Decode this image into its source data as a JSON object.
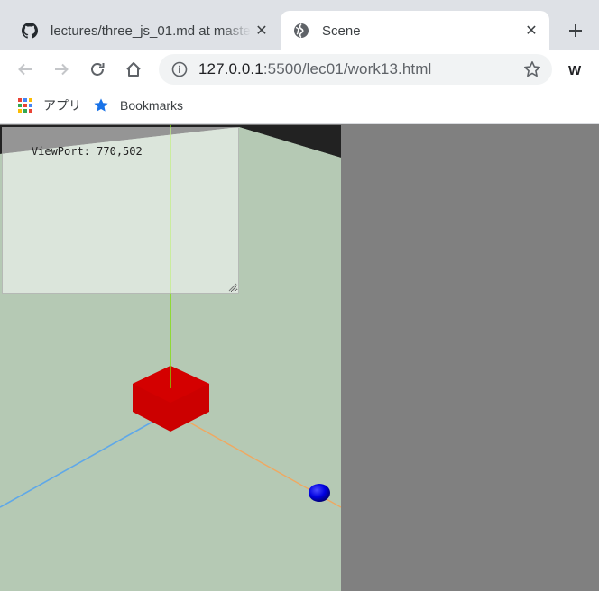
{
  "browser": {
    "tabs": [
      {
        "title": "lectures/three_js_01.md at master",
        "favicon": "github-icon",
        "active": false
      },
      {
        "title": "Scene",
        "favicon": "globe-icon",
        "active": true
      }
    ],
    "new_tab_icon": "plus-icon",
    "toolbar": {
      "back_icon": "arrow-left-icon",
      "forward_icon": "arrow-right-icon",
      "reload_icon": "reload-icon",
      "home_icon": "home-icon"
    },
    "address": {
      "host": "127.0.0.1",
      "path": ":5500/lec01/work13.html",
      "info_icon": "info-icon",
      "bookmark_icon": "star-outline-icon"
    },
    "extension_label": "W",
    "bookmarks": [
      {
        "label": "アプリ",
        "icon": "apps-grid-icon"
      },
      {
        "label": "Bookmarks",
        "icon": "star-filled-icon"
      }
    ]
  },
  "page": {
    "viewport_text": "ViewPort: 770,502"
  },
  "colors": {
    "scene_plane": "#b5c9b4",
    "page_background": "#808080",
    "cube": "#cc0000",
    "sphere": "#0000ee",
    "axis_y": "#7fe000",
    "axis_x": "#f0a860",
    "axis_z": "#5fa8e8"
  }
}
